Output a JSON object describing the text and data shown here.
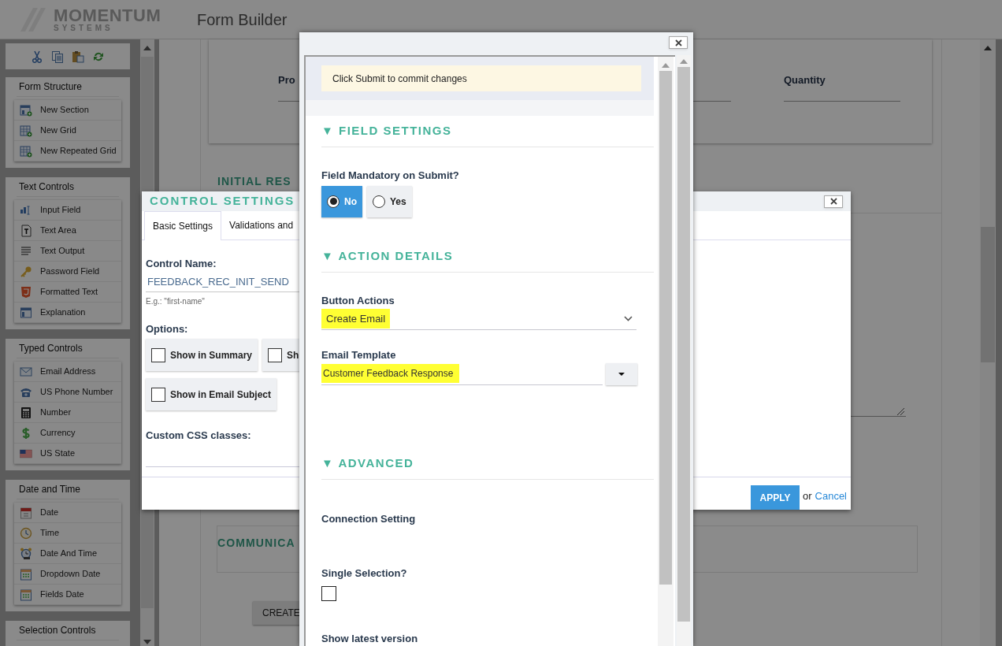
{
  "header": {
    "logo": "MOMENTUM",
    "logo_sub": "SYSTEMS",
    "title": "Form Builder"
  },
  "sidebar": {
    "panels": [
      {
        "title": "Form Structure",
        "items": [
          {
            "label": "New Section",
            "kind": "section"
          },
          {
            "label": "New Grid",
            "kind": "grid"
          },
          {
            "label": "New Repeated Grid",
            "kind": "grid"
          }
        ]
      },
      {
        "title": "Text Controls",
        "items": [
          {
            "label": "Input Field",
            "kind": "input"
          },
          {
            "label": "Text Area",
            "kind": "textarea"
          },
          {
            "label": "Text Output",
            "kind": "output"
          },
          {
            "label": "Password Field",
            "kind": "key"
          },
          {
            "label": "Formatted Text",
            "kind": "html"
          },
          {
            "label": "Explanation",
            "kind": "window"
          }
        ]
      },
      {
        "title": "Typed Controls",
        "items": [
          {
            "label": "Email Address",
            "kind": "email"
          },
          {
            "label": "US Phone Number",
            "kind": "phone"
          },
          {
            "label": "Number",
            "kind": "calc"
          },
          {
            "label": "Currency",
            "kind": "dollar"
          },
          {
            "label": "US State",
            "kind": "flag"
          }
        ]
      },
      {
        "title": "Date and Time",
        "items": [
          {
            "label": "Date",
            "kind": "calendar"
          },
          {
            "label": "Time",
            "kind": "clock"
          },
          {
            "label": "Date And Time",
            "kind": "alarm"
          },
          {
            "label": "Dropdown Date",
            "kind": "datefield"
          },
          {
            "label": "Fields Date",
            "kind": "datefield"
          }
        ]
      },
      {
        "title": "Selection Controls"
      }
    ]
  },
  "form": {
    "card_fields": [
      {
        "label": "Pro"
      },
      {
        "label": "Quantity"
      }
    ],
    "sections": [
      {
        "title": "INITIAL RES"
      },
      {
        "title": "COMMUNICA"
      }
    ],
    "create_button": "CREATE"
  },
  "control_settings": {
    "title": "CONTROL SETTINGS",
    "tabs": [
      {
        "label": "Basic Settings",
        "selected": true
      },
      {
        "label": "Validations and",
        "selected": false
      }
    ],
    "control_name_label": "Control Name:",
    "control_name": "FEEDBACK_REC_INIT_SEND",
    "control_name_hint": "E.g.: \"first-name\"",
    "options_label": "Options:",
    "options": [
      {
        "label": "Show in Summary",
        "checked": false
      },
      {
        "label": "Sh",
        "checked": false
      },
      {
        "label": "Show in Email Subject",
        "checked": false
      }
    ],
    "css_label": "Custom CSS classes:",
    "apply": "APPLY",
    "or": "or",
    "cancel": "Cancel"
  },
  "field_dialog": {
    "notice": "Click Submit to commit changes",
    "sections": [
      {
        "title": "▼ FIELD SETTINGS",
        "fields": [
          {
            "kind": "radio",
            "label": "Field Mandatory on Submit?",
            "options": [
              {
                "label": "No",
                "selected": true
              },
              {
                "label": "Yes",
                "selected": false
              }
            ]
          }
        ]
      },
      {
        "title": "▼ ACTION DETAILS",
        "fields": [
          {
            "kind": "select",
            "label": "Button Actions",
            "value": "Create Email",
            "highlighted": true
          },
          {
            "kind": "combo",
            "label": "Email Template",
            "value": "Customer Feedback Response",
            "highlighted": true
          }
        ]
      },
      {
        "title": "▼ ADVANCED",
        "fields": [
          {
            "kind": "label",
            "label": "Connection Setting"
          },
          {
            "kind": "checkbox",
            "label": "Single Selection?",
            "checked": false
          },
          {
            "kind": "label",
            "label": "Show latest version"
          }
        ]
      }
    ]
  }
}
